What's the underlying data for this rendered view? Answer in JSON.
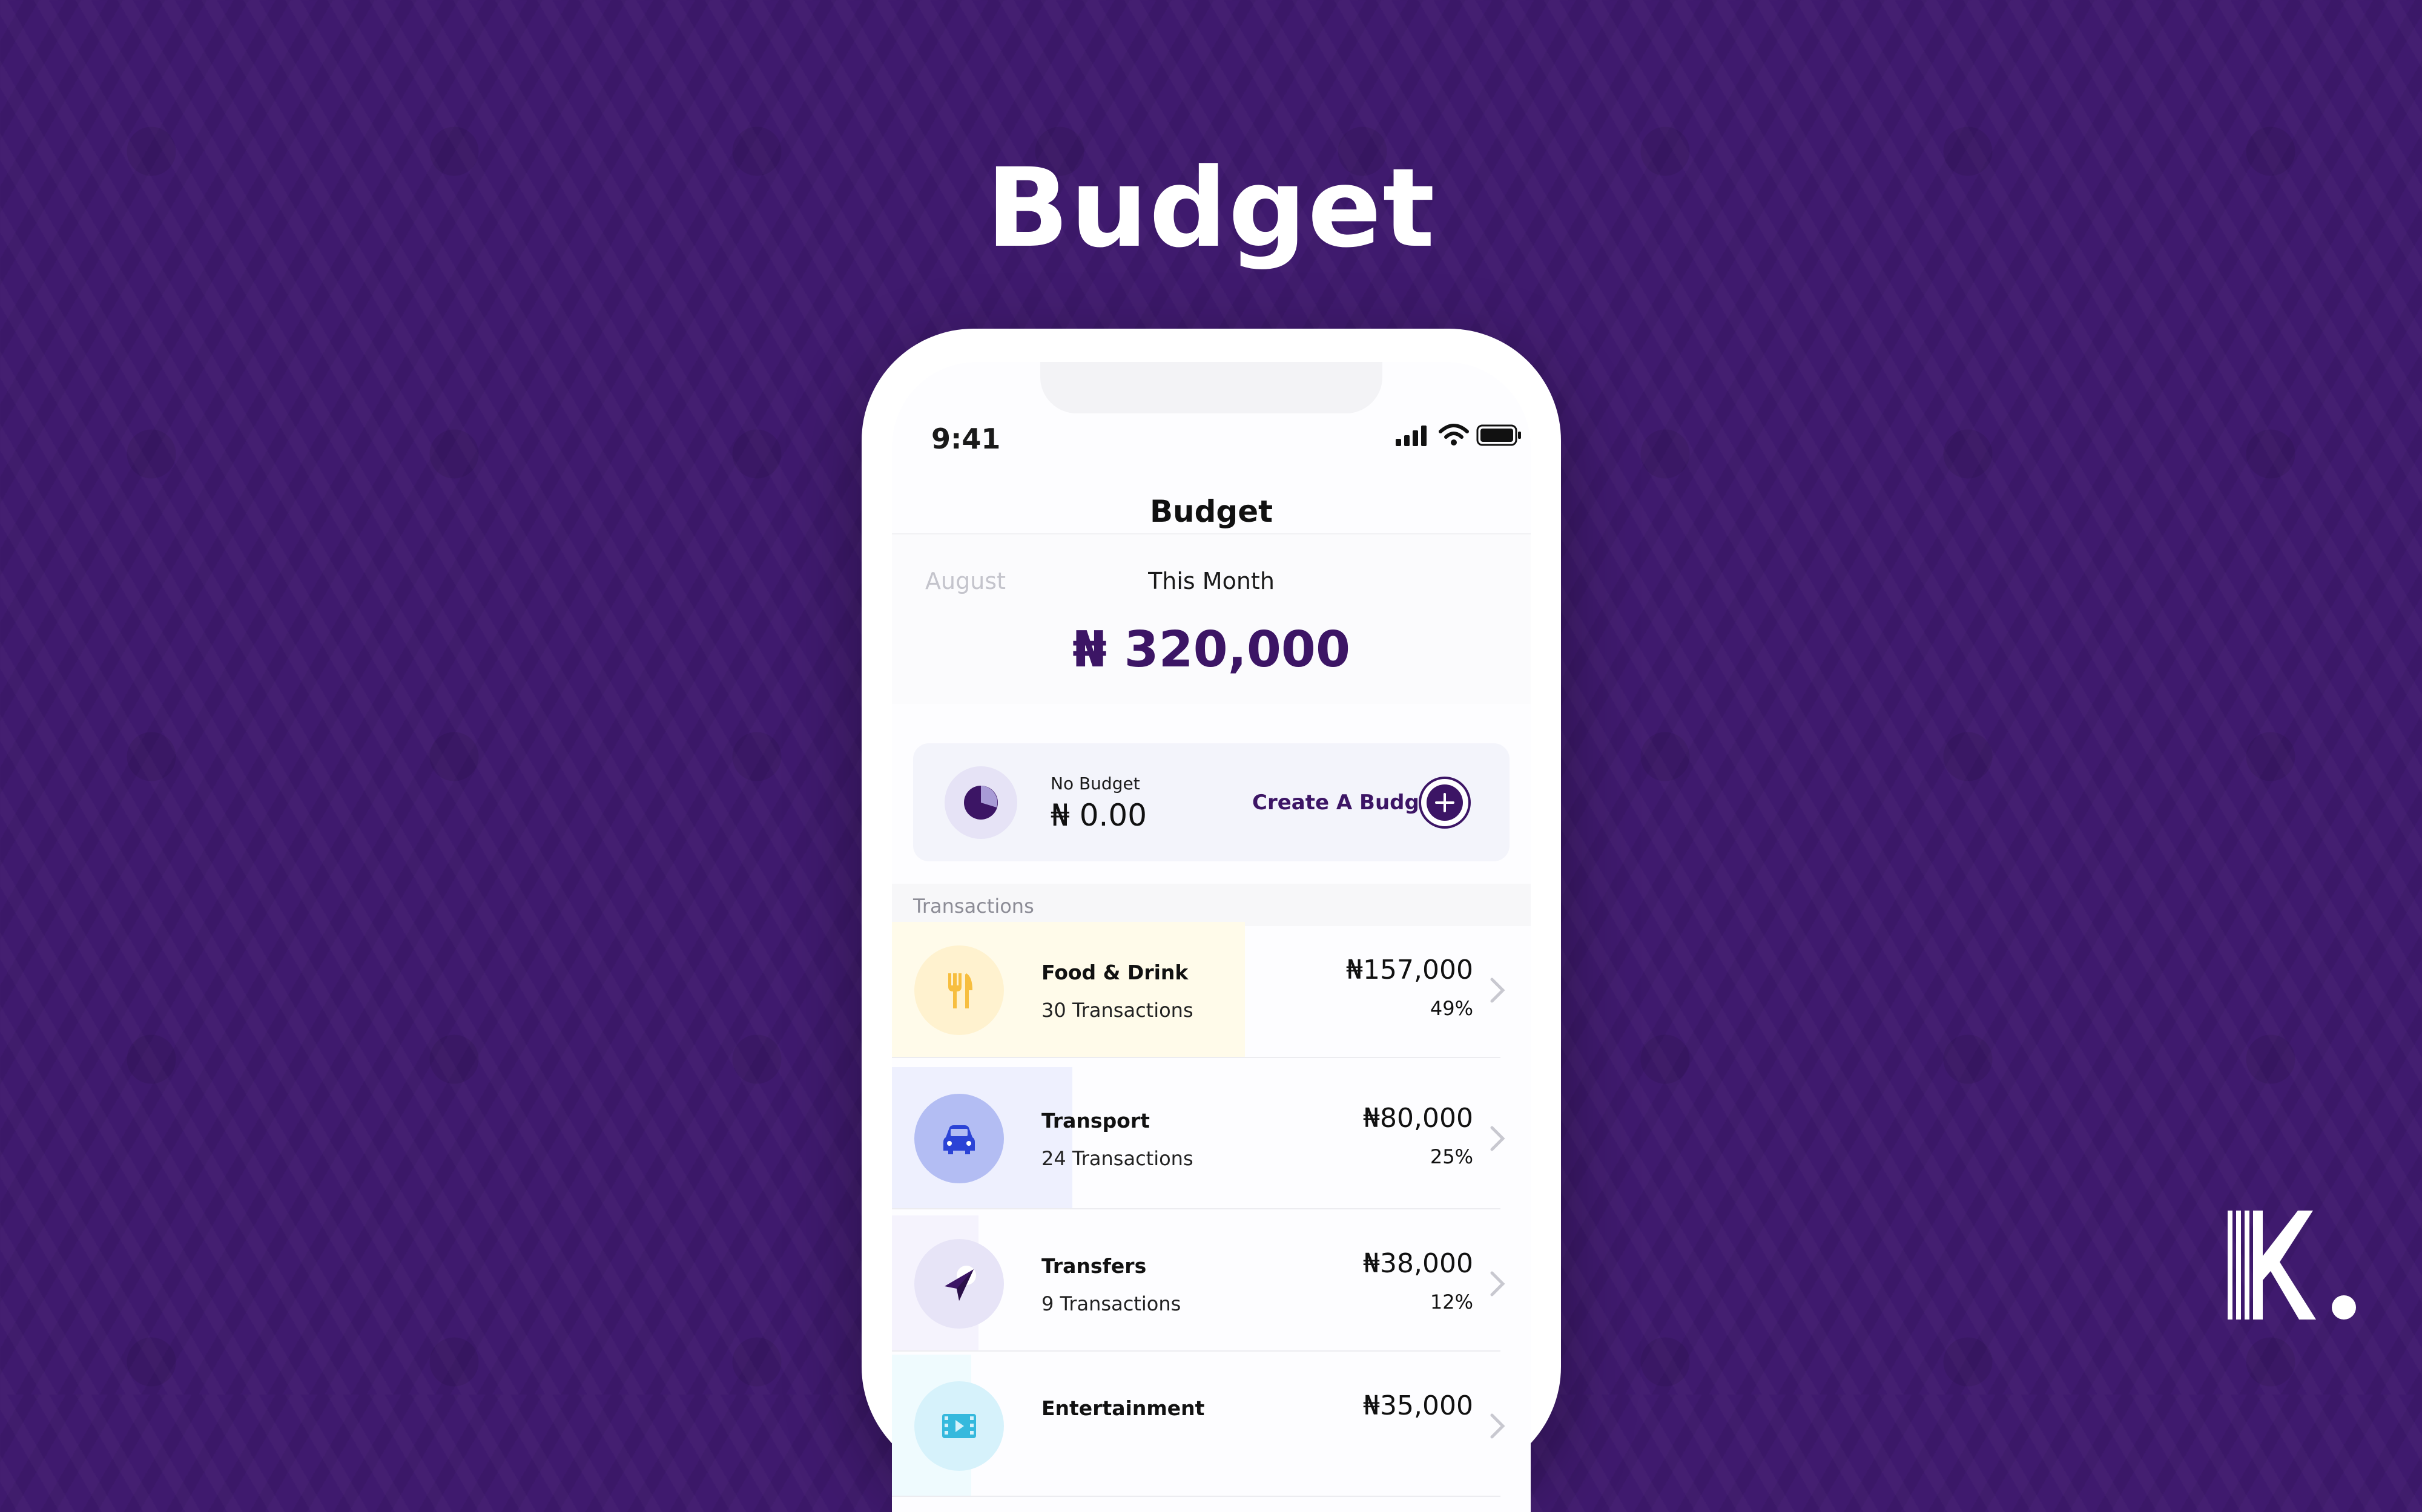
{
  "headline": "Budget",
  "status_bar": {
    "time": "9:41"
  },
  "screen": {
    "title": "Budget",
    "month_tabs": {
      "previous": "August",
      "current": "This Month"
    },
    "total": "₦ 320,000"
  },
  "budget_card": {
    "label": "No Budget",
    "amount": "₦ 0.00",
    "create_label": "Create A Budget"
  },
  "transactions": {
    "section_label": "Transactions",
    "items": [
      {
        "name": "Food & Drink",
        "count": "30 Transactions",
        "amount": "₦157,000",
        "percent": "49%",
        "share": 0.49,
        "icon": "fork-knife-icon",
        "color": "#f7be3f",
        "tint": "#fffbea",
        "circle": "#fff2cf"
      },
      {
        "name": "Transport",
        "count": "24 Transactions",
        "amount": "₦80,000",
        "percent": "25%",
        "share": 0.25,
        "icon": "car-icon",
        "color": "#2b43d6",
        "tint": "#eef0fe",
        "circle": "#b3bdf3"
      },
      {
        "name": "Transfers",
        "count": "9 Transactions",
        "amount": "₦38,000",
        "percent": "12%",
        "share": 0.12,
        "icon": "send-arrow-icon",
        "color": "#3c1565",
        "tint": "#f5f3fd",
        "circle": "#e7e4f7"
      },
      {
        "name": "Entertainment",
        "count": "",
        "amount": "₦35,000",
        "percent": "",
        "share": 0.11,
        "icon": "film-icon",
        "color": "#35b9dd",
        "tint": "#effbfe",
        "circle": "#d6f2fb"
      }
    ]
  },
  "colors": {
    "brand": "#3c1565",
    "background": "#3f1a6e"
  }
}
